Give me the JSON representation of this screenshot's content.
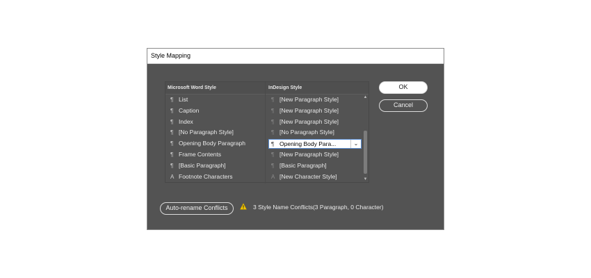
{
  "dialog": {
    "title": "Style Mapping",
    "columns": {
      "word": "Microsoft Word Style",
      "indesign": "InDesign Style"
    },
    "rows": [
      {
        "word_icon": "¶",
        "word": "List",
        "id_icon": "¶",
        "indesign": "[New Paragraph Style]"
      },
      {
        "word_icon": "¶",
        "word": "Caption",
        "id_icon": "¶",
        "indesign": "[New Paragraph Style]"
      },
      {
        "word_icon": "¶",
        "word": "Index",
        "id_icon": "¶",
        "indesign": "[New Paragraph Style]"
      },
      {
        "word_icon": "¶",
        "word": "[No Paragraph Style]",
        "id_icon": "¶",
        "indesign": "[No Paragraph Style]"
      },
      {
        "word_icon": "¶",
        "word": "Opening Body Paragraph",
        "id_icon": "¶",
        "indesign": "Opening Body Para..."
      },
      {
        "word_icon": "¶",
        "word": "Frame Contents",
        "id_icon": "¶",
        "indesign": "[New Paragraph Style]"
      },
      {
        "word_icon": "¶",
        "word": "[Basic Paragraph]",
        "id_icon": "¶",
        "indesign": "[Basic Paragraph]"
      },
      {
        "word_icon": "A",
        "word": "Footnote Characters",
        "id_icon": "A",
        "indesign": "[New Character Style]"
      }
    ],
    "buttons": {
      "ok": "OK",
      "cancel": "Cancel",
      "auto_rename": "Auto-rename Conflicts"
    },
    "status": "3 Style Name Conflicts(3 Paragraph, 0 Character)",
    "icons": {
      "warning": "warning-icon",
      "dropdown": "chevron-down-icon"
    },
    "colors": {
      "dialog_bg": "#535353",
      "warning": "#f2c500",
      "dropdown_border": "#5a8fd6"
    }
  }
}
